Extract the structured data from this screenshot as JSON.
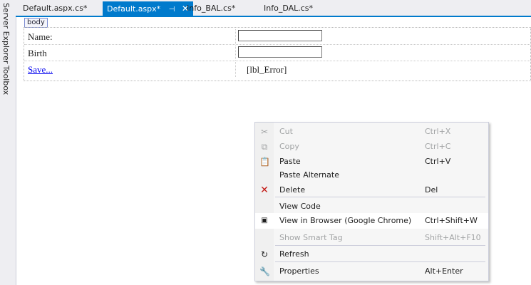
{
  "left_panels": [
    {
      "label": "Server Explorer"
    },
    {
      "label": "Toolbox"
    }
  ],
  "tabs": [
    {
      "label": "Default.aspx.cs*",
      "active": false
    },
    {
      "label": "Default.aspx*",
      "active": true
    },
    {
      "label": "Info_BAL.cs*",
      "active": false
    },
    {
      "label": "Info_DAL.cs*",
      "active": false
    }
  ],
  "tab_icons": {
    "pin": "pin-icon",
    "close": "close-icon"
  },
  "designer": {
    "body_tag": "body",
    "rows": [
      {
        "label": "Name:",
        "kind": "textbox"
      },
      {
        "label": "Birth",
        "kind": "textbox"
      },
      {
        "label": "Save...",
        "kind": "link",
        "right_text": "[lbl_Error]"
      }
    ]
  },
  "context_menu": {
    "items": [
      {
        "label": "Cut",
        "shortcut": "Ctrl+X",
        "icon": "scissors-icon",
        "enabled": false
      },
      {
        "label": "Copy",
        "shortcut": "Ctrl+C",
        "icon": "copy-icon",
        "enabled": false
      },
      {
        "label": "Paste",
        "shortcut": "Ctrl+V",
        "icon": "paste-icon",
        "enabled": true
      },
      {
        "label": "Paste Alternate",
        "shortcut": "",
        "icon": "",
        "enabled": true
      },
      {
        "label": "Delete",
        "shortcut": "Del",
        "icon": "delete-x-icon",
        "enabled": true
      },
      {
        "label": "View Code",
        "shortcut": "",
        "icon": "",
        "enabled": true
      },
      {
        "label": "View in Browser (Google Chrome)",
        "shortcut": "Ctrl+Shift+W",
        "icon": "browser-icon",
        "enabled": true
      },
      {
        "label": "Show Smart Tag",
        "shortcut": "Shift+Alt+F10",
        "icon": "",
        "enabled": false
      },
      {
        "label": "Refresh",
        "shortcut": "",
        "icon": "refresh-icon",
        "enabled": true
      },
      {
        "label": "Properties",
        "shortcut": "Alt+Enter",
        "icon": "wrench-icon",
        "enabled": true
      }
    ]
  },
  "colors": {
    "accent": "#007acc",
    "delete_icon": "#c41a16",
    "disabled_text": "#a2a4a5"
  }
}
